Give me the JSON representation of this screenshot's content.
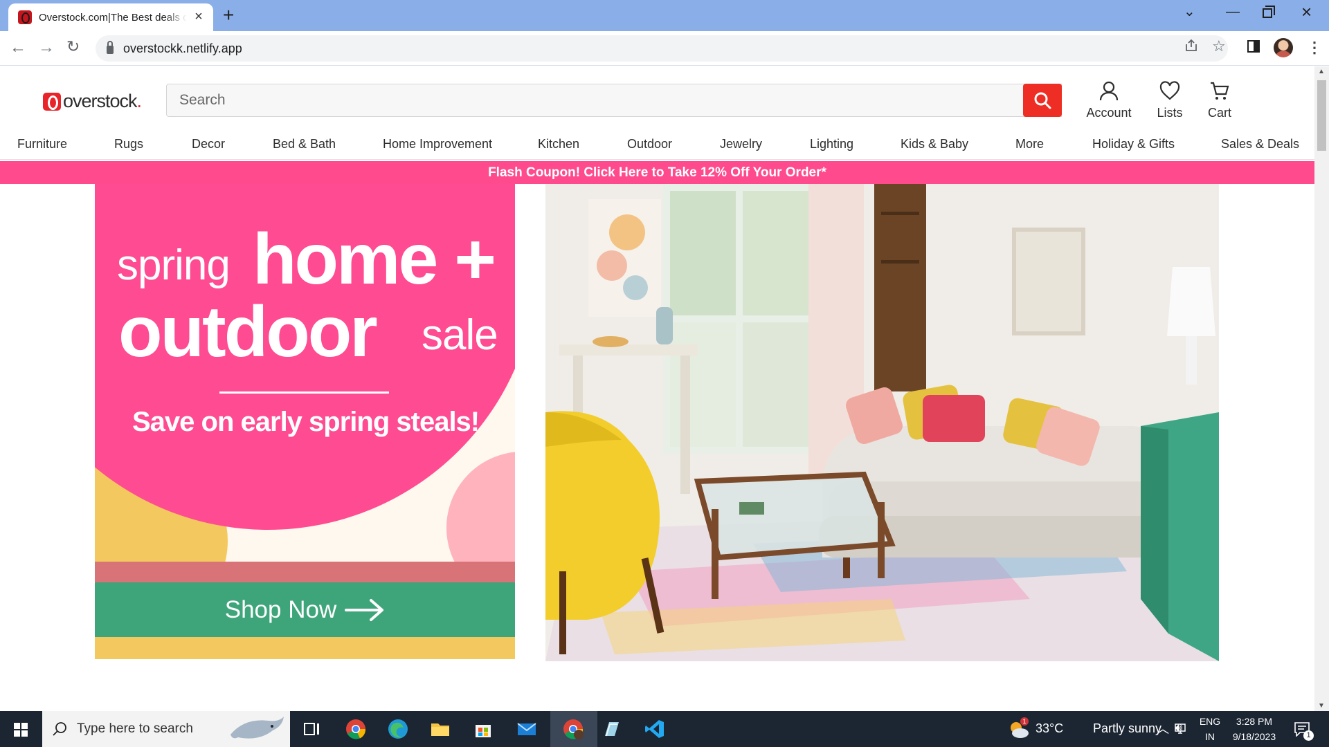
{
  "browser": {
    "tab_title": "Overstock.com|The Best deals on",
    "new_tab_label": "+",
    "url": "overstockk.netlify.app"
  },
  "site": {
    "logo_text": "overstock",
    "search_placeholder": "Search",
    "actions": [
      {
        "label": "Account",
        "icon": "user-icon"
      },
      {
        "label": "Lists",
        "icon": "heart-icon"
      },
      {
        "label": "Cart",
        "icon": "cart-icon"
      }
    ],
    "categories": [
      "Furniture",
      "Rugs",
      "Decor",
      "Bed & Bath",
      "Home Improvement",
      "Kitchen",
      "Outdoor",
      "Jewelry",
      "Lighting",
      "Kids & Baby",
      "More",
      "Holiday & Gifts",
      "Sales & Deals"
    ],
    "promo_banner": "Flash Coupon! Click Here to Take 12% Off Your Order*",
    "colors": {
      "brand_red": "#ee2e24",
      "promo_pink": "#ff4a8d",
      "hero_pink": "#ff4b91",
      "shop_green": "#3ea57a"
    }
  },
  "hero": {
    "word_spring": "spring",
    "word_home": "home +",
    "word_outdoor": "outdoor",
    "word_sale": "sale",
    "subtitle": "Save on early spring steals!",
    "cta_label": "Shop Now"
  },
  "taskbar": {
    "search_placeholder": "Type here to search",
    "weather_temp": "33°C",
    "weather_text": "Partly sunny",
    "weather_badge": "1",
    "lang_line1": "ENG",
    "lang_line2": "IN",
    "time": "3:28 PM",
    "date": "9/18/2023",
    "notification_count": "1"
  }
}
